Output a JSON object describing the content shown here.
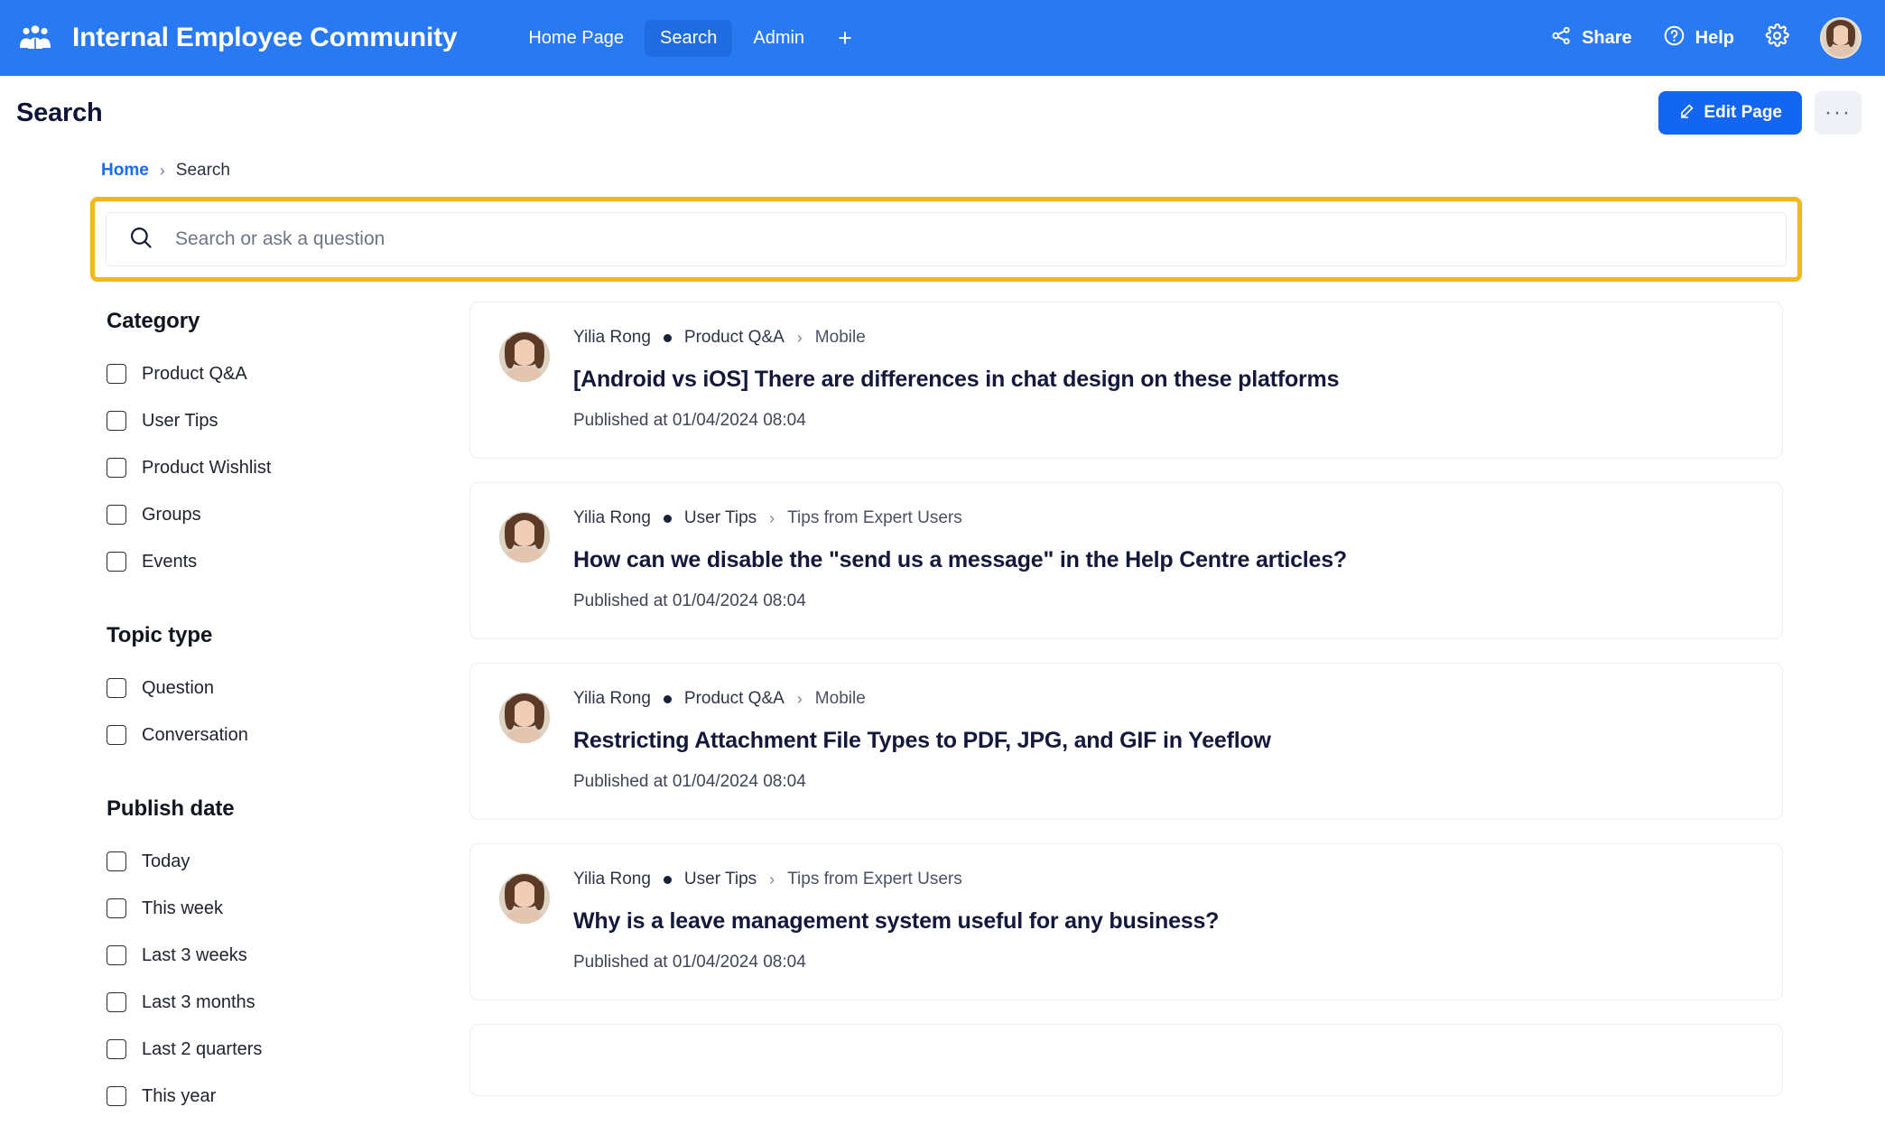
{
  "topbar": {
    "logo_icon": "people-group-icon",
    "title": "Internal Employee Community",
    "tabs": [
      {
        "label": "Home Page",
        "active": false
      },
      {
        "label": "Search",
        "active": true
      },
      {
        "label": "Admin",
        "active": false
      }
    ],
    "add_tab_label": "+",
    "share_label": "Share",
    "help_label": "Help",
    "accent_color": "#2979f2",
    "active_tab_color": "#1f6ce0"
  },
  "page_header": {
    "title": "Search",
    "edit_page_label": "Edit Page",
    "more_label": "···"
  },
  "breadcrumb": {
    "home": "Home",
    "separator": "›",
    "current": "Search"
  },
  "search": {
    "placeholder": "Search or ask a question",
    "value": "",
    "highlight_color": "#f5b81c"
  },
  "filters": [
    {
      "title": "Category",
      "options": [
        {
          "label": "Product Q&A",
          "checked": false
        },
        {
          "label": "User Tips",
          "checked": false
        },
        {
          "label": "Product Wishlist",
          "checked": false
        },
        {
          "label": "Groups",
          "checked": false
        },
        {
          "label": "Events",
          "checked": false
        }
      ]
    },
    {
      "title": "Topic type",
      "options": [
        {
          "label": "Question",
          "checked": false
        },
        {
          "label": "Conversation",
          "checked": false
        }
      ]
    },
    {
      "title": "Publish date",
      "options": [
        {
          "label": "Today",
          "checked": false
        },
        {
          "label": "This week",
          "checked": false
        },
        {
          "label": "Last 3 weeks",
          "checked": false
        },
        {
          "label": "Last 3 months",
          "checked": false
        },
        {
          "label": "Last 2 quarters",
          "checked": false
        },
        {
          "label": "This year",
          "checked": false
        }
      ]
    }
  ],
  "results": [
    {
      "author": "Yilia Rong",
      "category": "Product Q&A",
      "subcategory": "Mobile",
      "title": "[Android vs iOS] There are differences in chat design on these platforms",
      "date": "Published at 01/04/2024 08:04"
    },
    {
      "author": "Yilia Rong",
      "category": "User Tips",
      "subcategory": "Tips from Expert Users",
      "title": "How can we disable the \"send us a message\" in the Help Centre articles?",
      "date": "Published at 01/04/2024 08:04"
    },
    {
      "author": "Yilia Rong",
      "category": "Product Q&A",
      "subcategory": "Mobile",
      "title": "Restricting Attachment File Types to PDF, JPG, and GIF in Yeeflow",
      "date": "Published at 01/04/2024 08:04"
    },
    {
      "author": "Yilia Rong",
      "category": "User Tips",
      "subcategory": "Tips from Expert Users",
      "title": "Why is a leave management system useful for any business?",
      "date": "Published at 01/04/2024 08:04"
    },
    {
      "author": "Yilia Rong",
      "category": "",
      "subcategory": "",
      "title": "",
      "date": ""
    }
  ]
}
